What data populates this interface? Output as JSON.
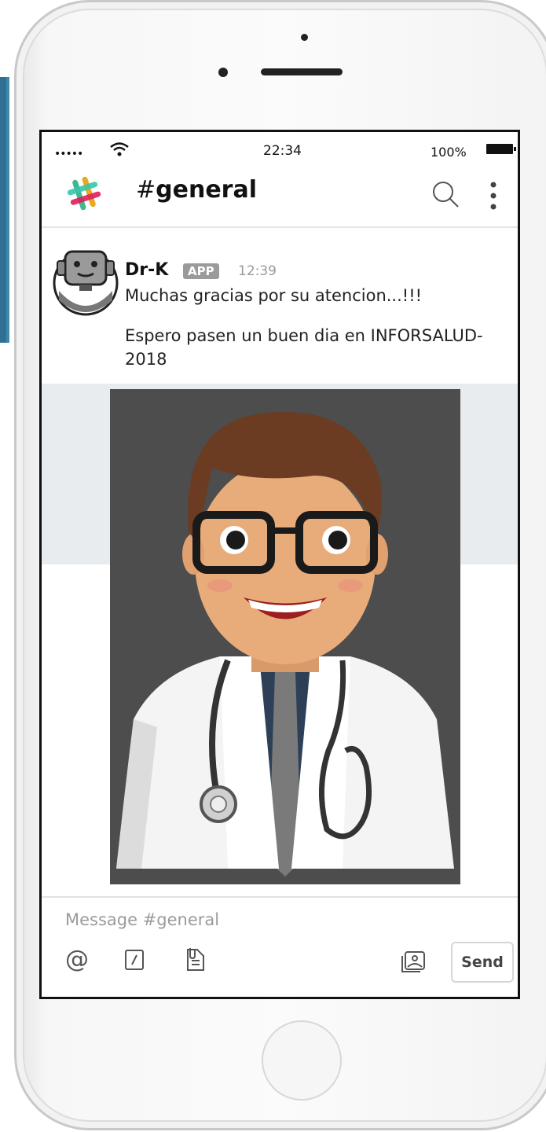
{
  "status_bar": {
    "signal": "•••••",
    "time": "22:34",
    "battery": "100%"
  },
  "header": {
    "channel_hash": "#",
    "channel_name": "general"
  },
  "message": {
    "sender": "Dr-K",
    "badge": "APP",
    "time": "12:39",
    "line1": "Muchas gracias por su atencion...!!!",
    "line2": "Espero pasen un buen dia en INFORSALUD-2018"
  },
  "composer": {
    "placeholder": "Message #general",
    "send_label": "Send"
  },
  "colors": {
    "brand_teal": "#36c5ab",
    "brand_yellow": "#e9a820",
    "brand_pink": "#e01e5a",
    "brand_blue": "#3eb890",
    "attachment_band": "#e9ecef"
  },
  "icons": [
    "wifi-icon",
    "battery-icon",
    "slack-logo-icon",
    "search-icon",
    "more-vertical-icon",
    "bot-avatar-icon",
    "at-icon",
    "slash-command-icon",
    "attach-file-icon",
    "image-icon"
  ]
}
